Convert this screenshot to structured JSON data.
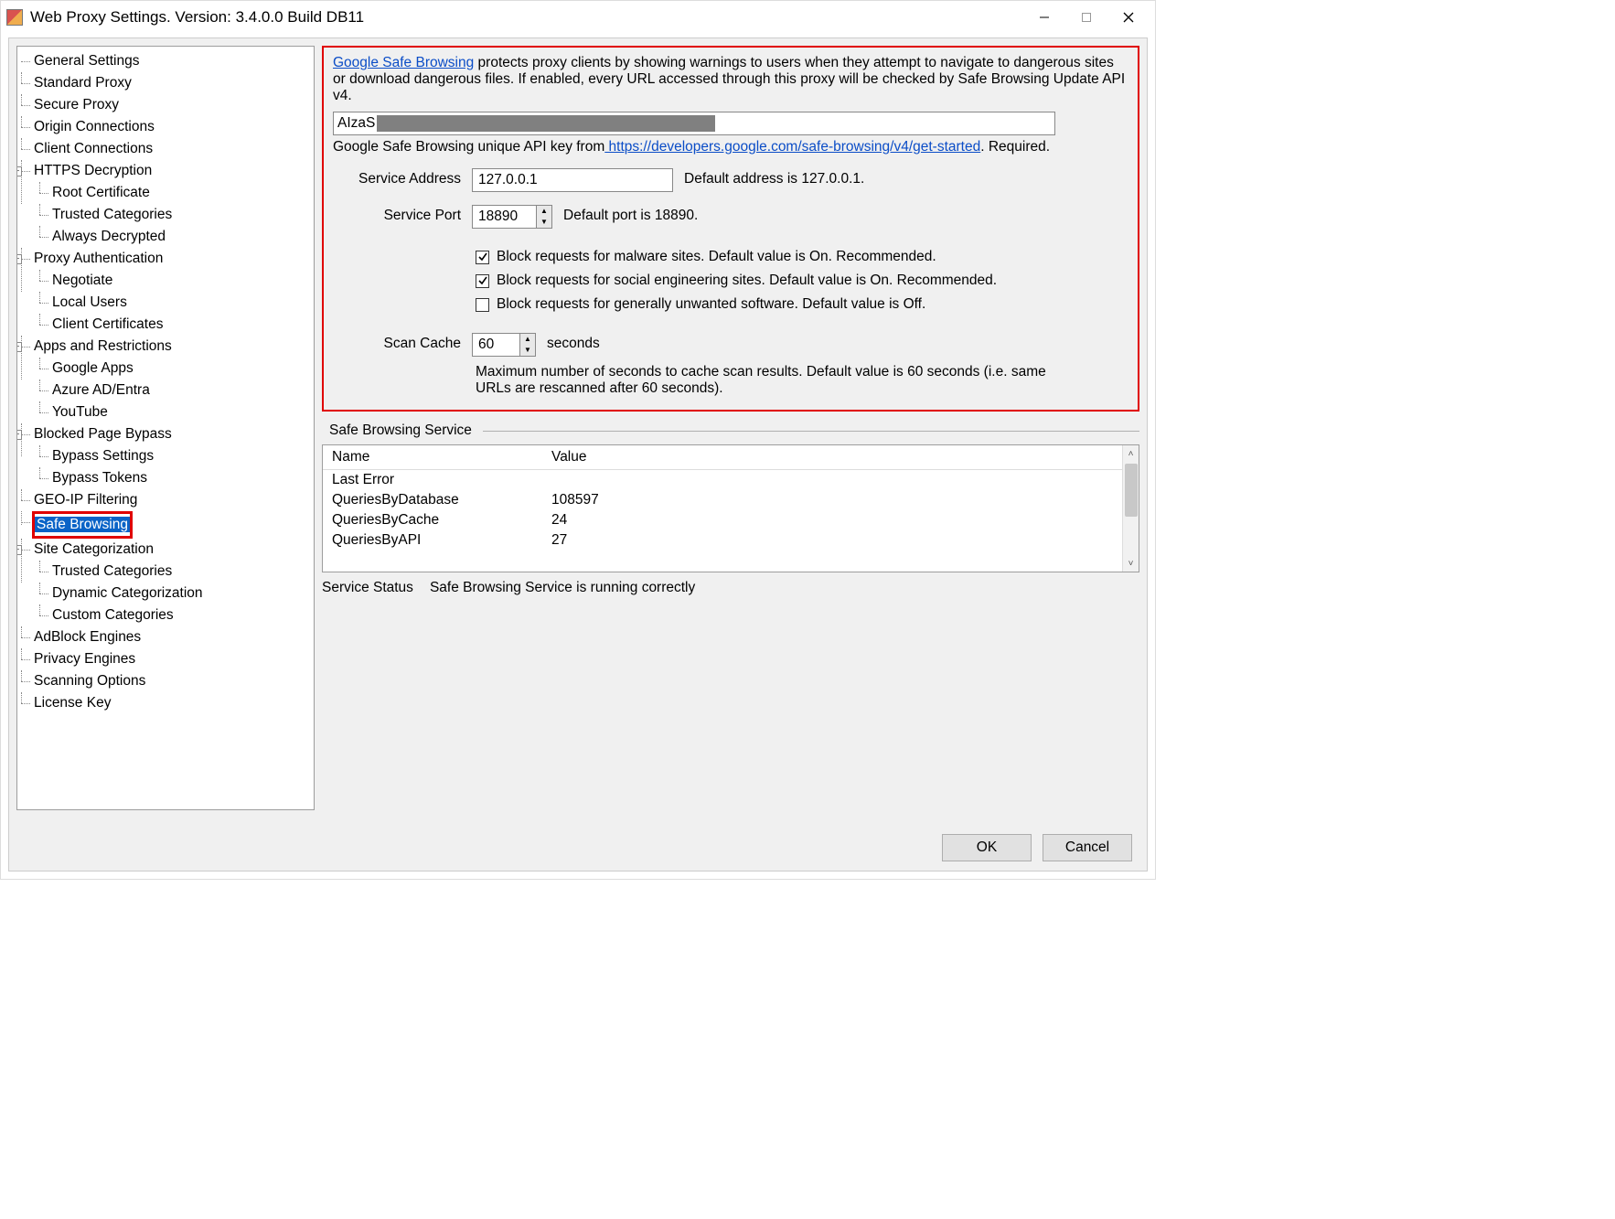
{
  "window": {
    "title": "Web Proxy Settings. Version: 3.4.0.0 Build DB11"
  },
  "tree": {
    "items": [
      {
        "label": "General Settings"
      },
      {
        "label": "Standard Proxy"
      },
      {
        "label": "Secure Proxy"
      },
      {
        "label": "Origin Connections"
      },
      {
        "label": "Client Connections"
      },
      {
        "label": "HTTPS Decryption",
        "exp": true,
        "children": [
          {
            "label": "Root Certificate"
          },
          {
            "label": "Trusted Categories"
          },
          {
            "label": "Always Decrypted"
          }
        ]
      },
      {
        "label": "Proxy Authentication",
        "exp": true,
        "children": [
          {
            "label": "Negotiate"
          },
          {
            "label": "Local Users"
          },
          {
            "label": "Client Certificates"
          }
        ]
      },
      {
        "label": "Apps and Restrictions",
        "exp": true,
        "children": [
          {
            "label": "Google Apps"
          },
          {
            "label": "Azure AD/Entra"
          },
          {
            "label": "YouTube"
          }
        ]
      },
      {
        "label": "Blocked Page Bypass",
        "exp": true,
        "children": [
          {
            "label": "Bypass Settings"
          },
          {
            "label": "Bypass Tokens"
          }
        ]
      },
      {
        "label": "GEO-IP Filtering"
      },
      {
        "label": "Safe Browsing",
        "selected": true,
        "redbox": true
      },
      {
        "label": "Site Categorization",
        "exp": true,
        "children": [
          {
            "label": "Trusted Categories"
          },
          {
            "label": "Dynamic Categorization"
          },
          {
            "label": "Custom Categories"
          }
        ]
      },
      {
        "label": "AdBlock Engines"
      },
      {
        "label": "Privacy Engines"
      },
      {
        "label": "Scanning Options"
      },
      {
        "label": "License Key"
      }
    ]
  },
  "main": {
    "intro_link": "Google Safe Browsing",
    "intro_rest": " protects proxy clients by showing warnings to users when they attempt to navigate to dangerous sites or download dangerous files. If enabled, every URL accessed through this proxy will be checked by Safe Browsing Update API v4.",
    "api_key_visible": "AIzaS",
    "api_help_pre": "Google Safe Browsing unique API key from",
    "api_help_link": " https://developers.google.com/safe-browsing/v4/get-started",
    "api_help_post": ". Required.",
    "service_address_label": "Service Address",
    "service_address_value": "127.0.0.1",
    "service_address_hint": "Default address is 127.0.0.1.",
    "service_port_label": "Service Port",
    "service_port_value": "18890",
    "service_port_hint": "Default port is 18890.",
    "chk_malware": "Block requests for malware sites. Default value is On. Recommended.",
    "chk_social": "Block requests for social engineering sites. Default value is On. Recommended.",
    "chk_unwanted": "Block requests for generally unwanted software. Default value is Off.",
    "scan_cache_label": "Scan Cache",
    "scan_cache_value": "60",
    "scan_cache_unit": "seconds",
    "scan_cache_help": "Maximum number of seconds to cache scan results. Default value is 60 seconds (i.e. same URLs are rescanned after 60 seconds)."
  },
  "service_group": {
    "title": "Safe Browsing Service",
    "col_name": "Name",
    "col_value": "Value",
    "rows": [
      {
        "name": "Last Error",
        "value": ""
      },
      {
        "name": "QueriesByDatabase",
        "value": "108597"
      },
      {
        "name": "QueriesByCache",
        "value": "24"
      },
      {
        "name": "QueriesByAPI",
        "value": "27"
      }
    ],
    "status_label": "Service Status",
    "status_value": "Safe Browsing Service is running correctly"
  },
  "buttons": {
    "ok": "OK",
    "cancel": "Cancel"
  }
}
